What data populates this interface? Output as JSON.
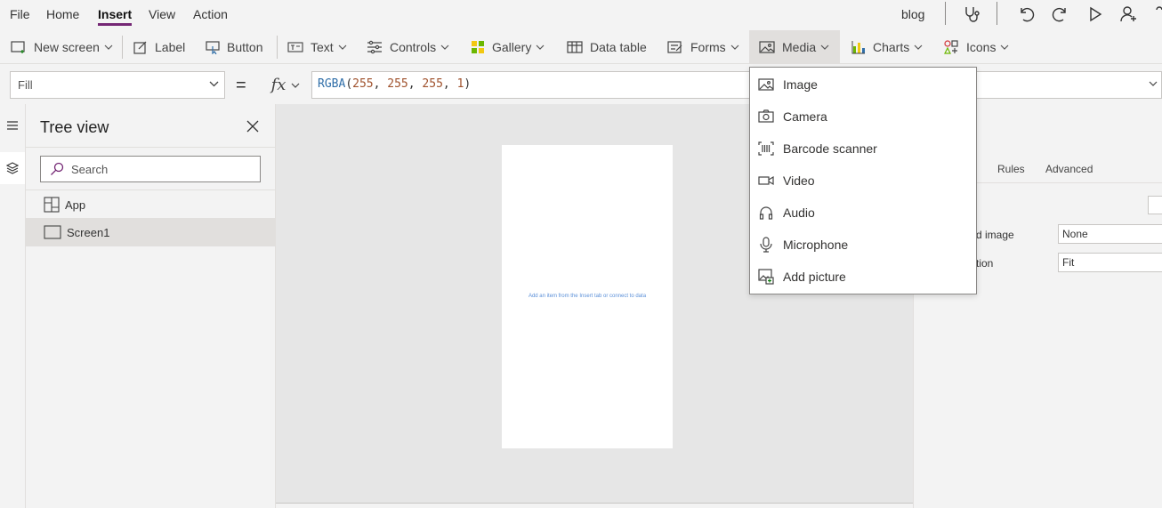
{
  "menu": {
    "items": [
      {
        "label": "File"
      },
      {
        "label": "Home"
      },
      {
        "label": "Insert"
      },
      {
        "label": "View"
      },
      {
        "label": "Action"
      }
    ],
    "active": "Insert",
    "app_name": "blog"
  },
  "ribbon": {
    "new_screen": "New screen",
    "label": "Label",
    "button": "Button",
    "text": "Text",
    "controls": "Controls",
    "gallery": "Gallery",
    "data_table": "Data table",
    "forms": "Forms",
    "media": "Media",
    "charts": "Charts",
    "icons": "Icons"
  },
  "formula_bar": {
    "property": "Fill",
    "equals": "=",
    "fx": "fx",
    "fn": "RGBA",
    "open": "(",
    "args": [
      "255",
      "255",
      "255",
      "1"
    ],
    "sep": ", ",
    "close": ")"
  },
  "tree_view": {
    "title": "Tree view",
    "search_placeholder": "Search",
    "items": [
      {
        "label": "App",
        "selected": false
      },
      {
        "label": "Screen1",
        "selected": true
      }
    ]
  },
  "canvas": {
    "hint": "Add an item from the Insert tab or connect to data"
  },
  "properties": {
    "tabs": [
      "Rules",
      "Advanced"
    ],
    "rows": [
      {
        "label": "d image",
        "value": "None"
      },
      {
        "label": "tion",
        "value": "Fit"
      }
    ]
  },
  "media_menu": {
    "items": [
      {
        "label": "Image",
        "icon": "image-icon"
      },
      {
        "label": "Camera",
        "icon": "camera-icon"
      },
      {
        "label": "Barcode scanner",
        "icon": "barcode-icon"
      },
      {
        "label": "Video",
        "icon": "video-icon"
      },
      {
        "label": "Audio",
        "icon": "headphones-icon"
      },
      {
        "label": "Microphone",
        "icon": "microphone-icon"
      },
      {
        "label": "Add picture",
        "icon": "add-picture-icon"
      }
    ]
  },
  "colors": {
    "accent": "#742774",
    "formula_function": "#2f6ea8",
    "formula_number": "#a0522d",
    "canvas_hint": "#5a8fd8"
  }
}
